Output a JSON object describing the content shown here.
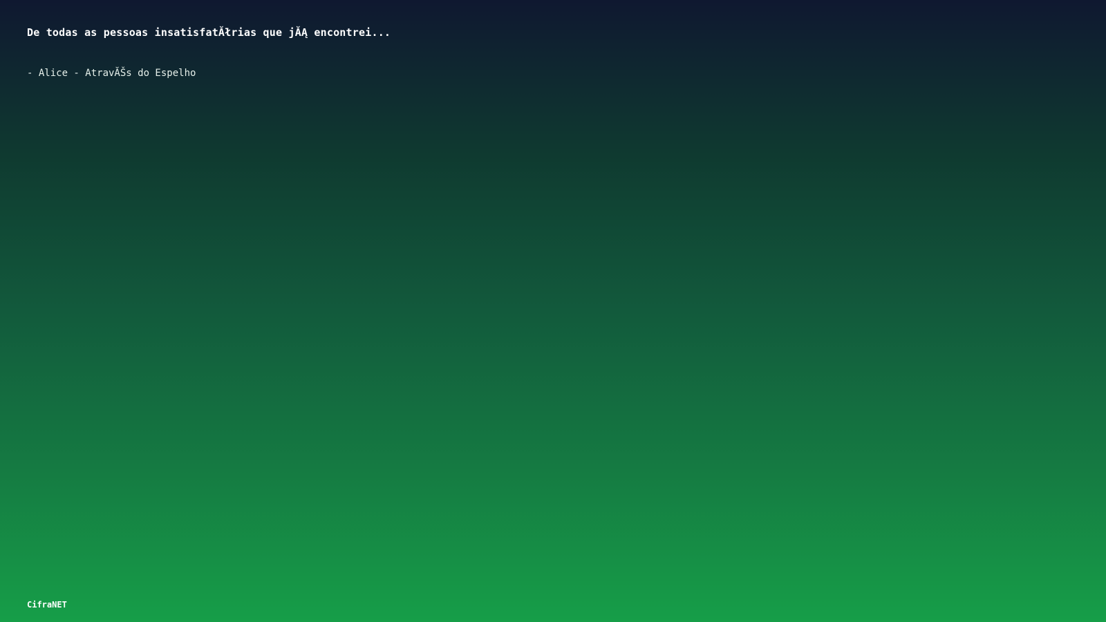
{
  "screen": {
    "quote": "De todas as pessoas insatisfatĂłrias que jĂĄ encontrei...",
    "attribution": "- Alice - AtravĂŠs do Espelho",
    "brand": "CifraNET"
  },
  "colors": {
    "gradient_top": "#0f1830",
    "gradient_bottom": "#169e48",
    "text": "#ffffff"
  }
}
